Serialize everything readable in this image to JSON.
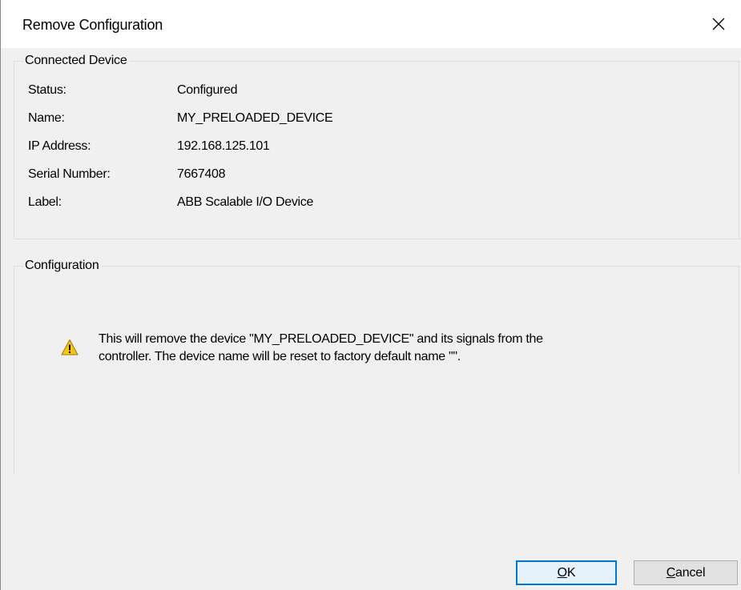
{
  "dialog": {
    "title": "Remove Configuration",
    "close_icon": "close-icon"
  },
  "connected_device": {
    "legend": "Connected Device",
    "rows": [
      {
        "label": "Status:",
        "value": "Configured"
      },
      {
        "label": "Name:",
        "value": "MY_PRELOADED_DEVICE"
      },
      {
        "label": "IP Address:",
        "value": "192.168.125.101"
      },
      {
        "label": "Serial Number:",
        "value": "7667408"
      },
      {
        "label": "Label:",
        "value": "ABB Scalable I/O Device"
      }
    ]
  },
  "configuration": {
    "legend": "Configuration",
    "warning_icon": "warning-icon",
    "warning_line1": "This will remove the device \"MY_PRELOADED_DEVICE\" and its signals from the",
    "warning_line2": "controller. The device name will be reset to factory default name \"\"."
  },
  "buttons": {
    "ok_mnemonic": "O",
    "ok_rest": "K",
    "cancel_mnemonic": "C",
    "cancel_rest": "ancel"
  },
  "colors": {
    "background": "#f0f0f0",
    "titlebar": "#ffffff",
    "group_border": "#d5dfe5",
    "default_button_border": "#0078d7",
    "warning_yellow": "#f5c518"
  }
}
